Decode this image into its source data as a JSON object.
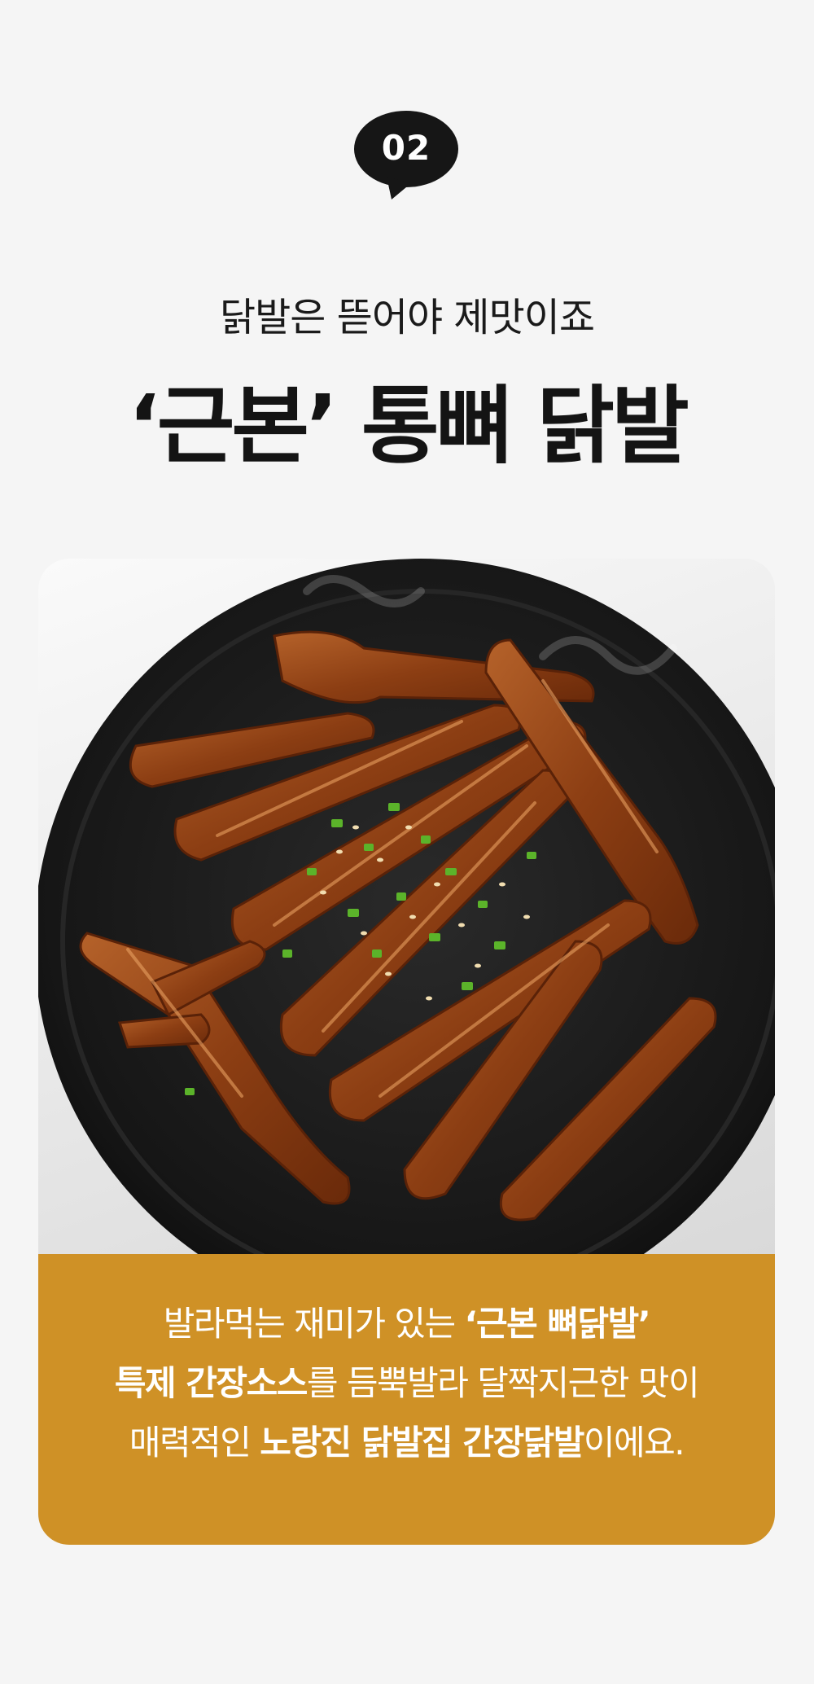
{
  "badge": {
    "number": "02"
  },
  "heading": {
    "subtitle": "닭발은 뜯어야 제맛이죠",
    "title": "‘근본’ 통뼈 닭발"
  },
  "photo": {
    "icon": "chicken-feet-dish-photo",
    "colors": {
      "plate": "#1b1b1b",
      "sauce": "#8a3f12",
      "garnish": "#5bb32a"
    }
  },
  "caption": {
    "line1": {
      "a": "발라먹는 재미가 있는 ",
      "b": "‘근본 뼈닭발’"
    },
    "line2": {
      "a": "특제 간장소스",
      "b": "를 듬뿍발라 달짝지근한 맛이"
    },
    "line3": {
      "a": "매력적인 ",
      "b": "노랑진 닭발집 간장닭발",
      "c": "이에요."
    },
    "background": "#cf9126"
  }
}
